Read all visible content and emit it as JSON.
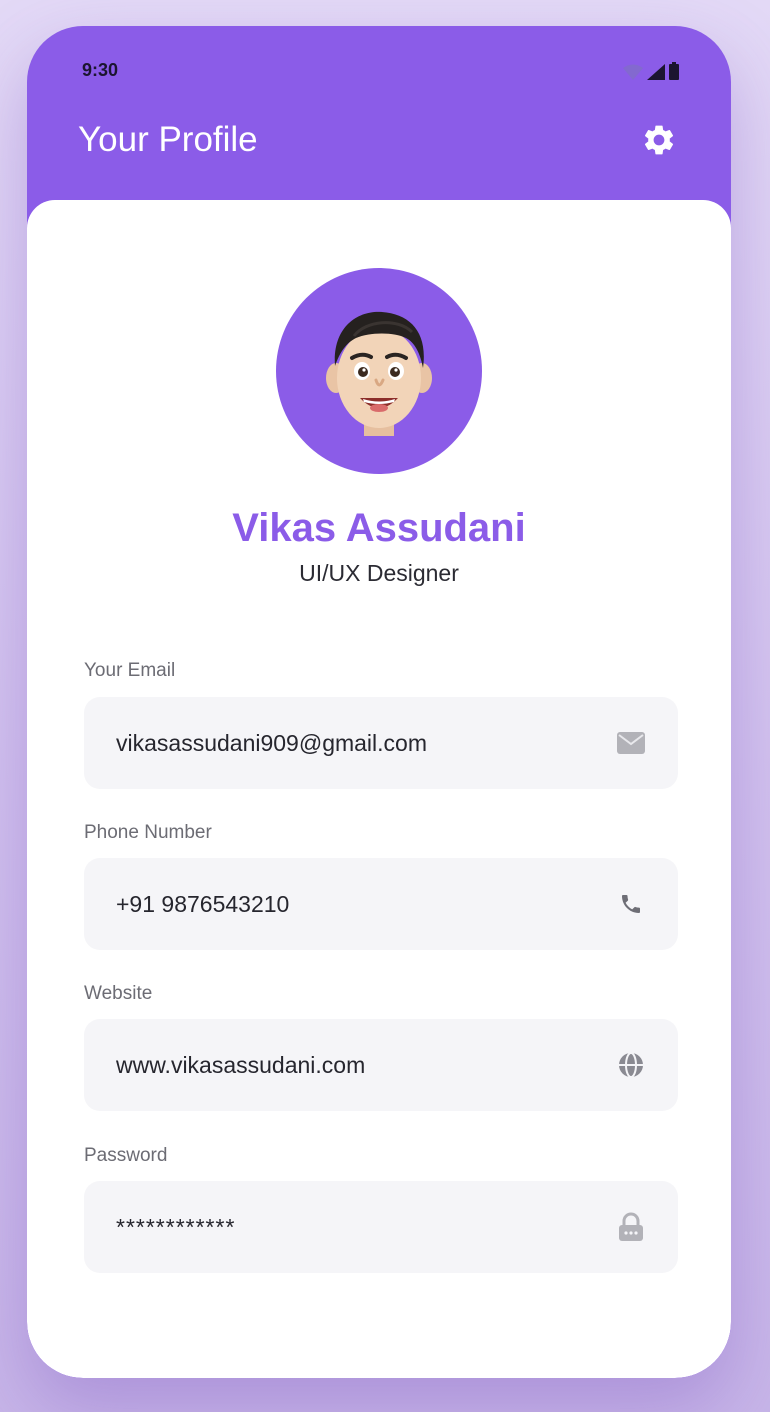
{
  "status_bar": {
    "time": "9:30"
  },
  "header": {
    "title": "Your Profile",
    "settings_icon": "gear-icon"
  },
  "profile": {
    "name": "Vikas Assudani",
    "role": "UI/UX Designer",
    "avatar": "memoji-avatar"
  },
  "fields": [
    {
      "label": "Your Email",
      "value": "vikasassudani909@gmail.com",
      "icon": "mail-icon"
    },
    {
      "label": "Phone Number",
      "value": "+91 9876543210",
      "icon": "phone-icon"
    },
    {
      "label": "Website",
      "value": "www.vikasassudani.com",
      "icon": "globe-icon"
    },
    {
      "label": "Password",
      "value": "************",
      "icon": "lock-icon"
    }
  ],
  "colors": {
    "accent": "#8b5ce8",
    "field_background": "#f5f5f8",
    "background": "#d8caf1"
  }
}
